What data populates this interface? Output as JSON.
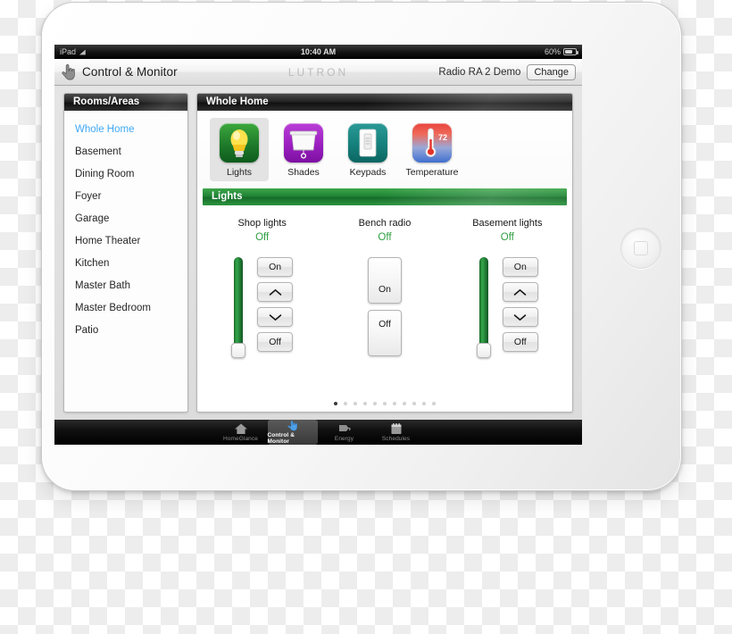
{
  "status_bar": {
    "device_label": "iPad",
    "wifi_icon": "wifi-icon",
    "time": "10:40 AM",
    "battery_percent": "60%",
    "battery_icon": "battery-icon"
  },
  "navbar": {
    "cursor_icon": "hand-pointer-icon",
    "title": "Control & Monitor",
    "brand": "LUTRON",
    "project_name": "Radio RA 2 Demo",
    "change_label": "Change"
  },
  "sidebar": {
    "header": "Rooms/Areas",
    "items": [
      {
        "label": "Whole Home",
        "selected": true
      },
      {
        "label": "Basement",
        "selected": false
      },
      {
        "label": "Dining Room",
        "selected": false
      },
      {
        "label": "Foyer",
        "selected": false
      },
      {
        "label": "Garage",
        "selected": false
      },
      {
        "label": "Home Theater",
        "selected": false
      },
      {
        "label": "Kitchen",
        "selected": false
      },
      {
        "label": "Master Bath",
        "selected": false
      },
      {
        "label": "Master Bedroom",
        "selected": false
      },
      {
        "label": "Patio",
        "selected": false
      }
    ]
  },
  "main": {
    "area_header": "Whole Home",
    "categories": [
      {
        "label": "Lights",
        "icon": "lightbulb-icon",
        "selected": true
      },
      {
        "label": "Shades",
        "icon": "roller-shade-icon",
        "selected": false
      },
      {
        "label": "Keypads",
        "icon": "wall-keypad-icon",
        "selected": false
      },
      {
        "label": "Temperature",
        "icon": "thermometer-icon",
        "selected": false,
        "reading": "72"
      }
    ],
    "section_header": "Lights",
    "devices": [
      {
        "name": "Shop lights",
        "state": "Off",
        "type": "dimmer",
        "on_label": "On",
        "raise_icon": "chevron-up-icon",
        "lower_icon": "chevron-down-icon",
        "off_label": "Off"
      },
      {
        "name": "Bench radio",
        "state": "Off",
        "type": "switch",
        "on_label": "On",
        "off_label": "Off"
      },
      {
        "name": "Basement lights",
        "state": "Off",
        "type": "dimmer",
        "on_label": "On",
        "raise_icon": "chevron-up-icon",
        "lower_icon": "chevron-down-icon",
        "off_label": "Off"
      }
    ],
    "page_dots": {
      "count": 11,
      "active_index": 0
    }
  },
  "tab_bar": {
    "tabs": [
      {
        "label": "HomeGlance",
        "icon": "house-icon",
        "selected": false
      },
      {
        "label": "Control & Monitor",
        "icon": "hand-pointer-icon",
        "selected": true
      },
      {
        "label": "Energy",
        "icon": "power-plug-icon",
        "selected": false
      },
      {
        "label": "Schedules",
        "icon": "calendar-icon",
        "selected": false
      }
    ]
  },
  "colors": {
    "accent_green": "#2f9e41",
    "selected_blue": "#3fa9f5",
    "lights_icon": "#1e7a2a",
    "shades_icon": "#9b1fc0",
    "keypads_icon": "#15807c"
  }
}
